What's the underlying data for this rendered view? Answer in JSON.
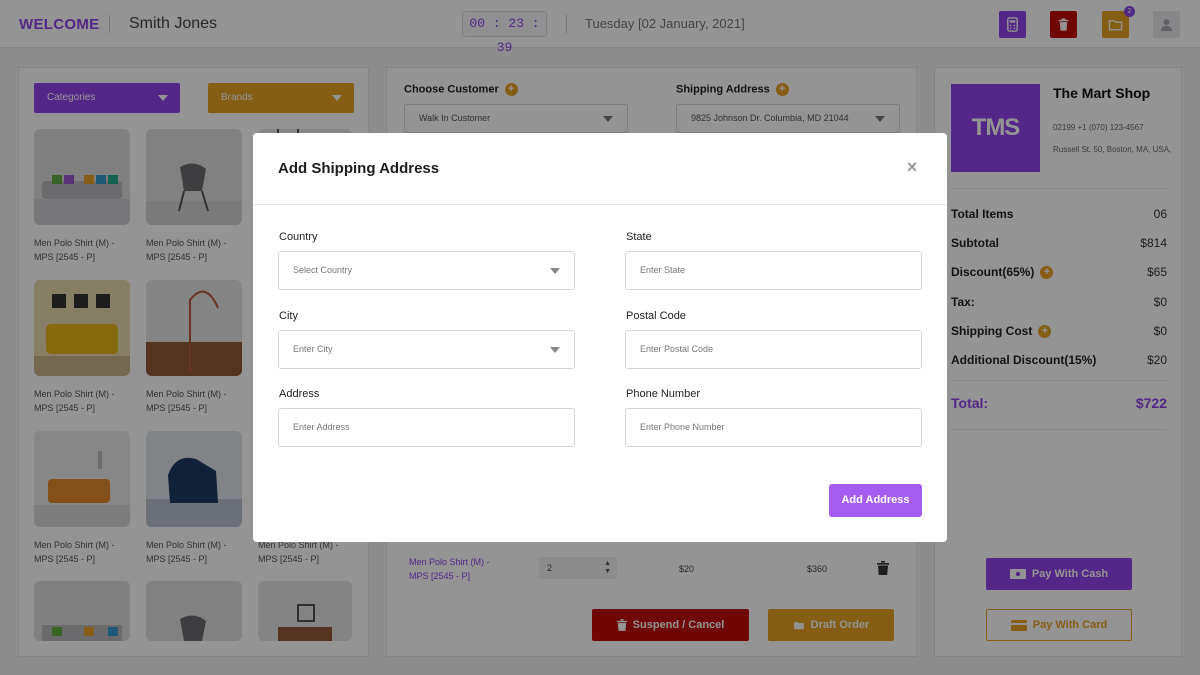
{
  "header": {
    "welcome": "WELCOME",
    "user_name": "Smith Jones",
    "timer": "00 : 23 : 39",
    "date": "Tuesday [02 January, 2021]",
    "folder_badge": "2",
    "icons": [
      "calculator-icon",
      "trash-icon",
      "folder-icon",
      "user-icon"
    ]
  },
  "catalog": {
    "categories_label": "Categories",
    "brands_label": "Brands",
    "products": [
      {
        "name": "Men Polo Shirt (M) - MPS [2545 - P]"
      },
      {
        "name": "Men Polo Shirt (M) - MPS [2545 - P]"
      },
      {
        "name": "Men Polo Shirt (M) - MPS [2545 - P]"
      },
      {
        "name": "Men Polo Shirt (M) - MPS [2545 - P]"
      },
      {
        "name": "Men Polo Shirt (M) - MPS [2545 - P]"
      },
      {
        "name": "Men Polo Shirt (M) - MPS [2545 - P]"
      },
      {
        "name": "Men Polo Shirt (M) - MPS [2545 - P]"
      }
    ]
  },
  "order": {
    "choose_customer_label": "Choose Customer",
    "customer_value": "Walk In Customer",
    "shipping_address_label": "Shipping Address",
    "shipping_address_value": "9825 Johnson Dr. Columbia, MD 21044",
    "line_item": {
      "name": "Men Polo Shirt (M) - MPS [2545 - P]",
      "qty": "2",
      "price": "$20",
      "total": "$360"
    },
    "suspend_label": "Suspend / Cancel",
    "draft_label": "Draft Order"
  },
  "summary": {
    "logo_text": "TMS",
    "shop_name": "The Mart Shop",
    "phone": "02199 +1 (070) 123-4567",
    "address": "Russell St. 50, Boston, MA, USA,",
    "rows": [
      {
        "label": "Total Items",
        "value": "06"
      },
      {
        "label": "Subtotal",
        "value": "$814"
      },
      {
        "label": "Discount(65%)",
        "value": "$65"
      },
      {
        "label": "Tax:",
        "value": "$0"
      },
      {
        "label": "Shipping Cost",
        "value": "$0"
      },
      {
        "label": "Additional Discount(15%)",
        "value": "$20"
      }
    ],
    "total_label": "Total:",
    "total_value": "$722",
    "pay_cash_label": "Pay With Cash",
    "pay_card_label": "Pay With Card"
  },
  "modal": {
    "title": "Add Shipping Address",
    "country_label": "Country",
    "country_placeholder": "Select Country",
    "state_label": "State",
    "state_placeholder": "Enter State",
    "city_label": "City",
    "city_placeholder": "Enter City",
    "postal_label": "Postal Code",
    "postal_placeholder": "Enter Postal Code",
    "address_label": "Address",
    "address_placeholder": "Enter Address",
    "phone_label": "Phone Number",
    "phone_placeholder": "Enter Phone Number",
    "submit_label": "Add Address"
  },
  "colors": {
    "purple": "#8e44e8",
    "orange": "#e5a023",
    "red": "#c00d0d",
    "add_button": "#a65cf0"
  }
}
